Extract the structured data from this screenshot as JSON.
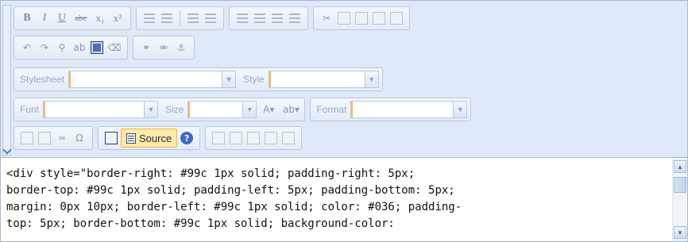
{
  "toolbar": {
    "row1": {
      "bold": "B",
      "italic": "I",
      "underline": "U",
      "strike": "abc",
      "subscript": "x₁",
      "superscript": "x²"
    },
    "styles": {
      "stylesheet_label": "Stylesheet",
      "stylesheet_value": "",
      "style_label": "Style",
      "style_value": ""
    },
    "fonts": {
      "font_label": "Font",
      "font_value": "",
      "size_label": "Size",
      "size_value": "",
      "format_label": "Format",
      "format_value": ""
    },
    "row5": {
      "source_label": "Source",
      "help_glyph": "?"
    }
  },
  "content": {
    "lines": [
      "<div style=\"border-right: #99c 1px solid; padding-right: 5px;",
      "border-top: #99c 1px solid; padding-left: 5px; padding-bottom: 5px;",
      "margin: 0px 10px; border-left: #99c 1px solid; color: #036; padding-",
      "top: 5px; border-bottom: #99c 1px solid; background-color:"
    ]
  },
  "colors": {
    "toolbar_bg": "#dfe8f6",
    "border": "#a3bad9",
    "source_highlight": "#ffe9a6",
    "focus_accent": "#ffb84d"
  }
}
